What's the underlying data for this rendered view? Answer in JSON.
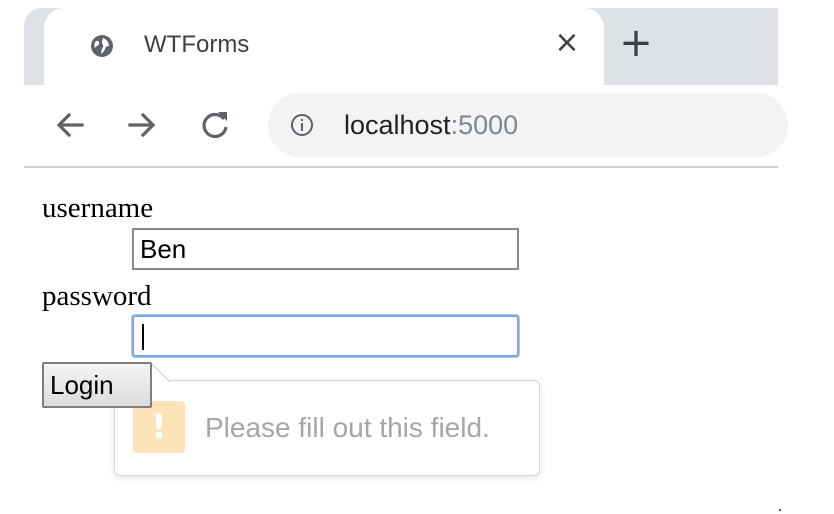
{
  "browser": {
    "tab": {
      "title": "WTForms",
      "favicon": "globe-icon",
      "close_symbol": "×"
    },
    "new_tab_symbol": "+",
    "nav": {
      "back": "arrow-left-icon",
      "forward": "arrow-right-icon",
      "reload": "reload-icon"
    },
    "address": {
      "info": "info-icon",
      "host": "localhost",
      "port": ":5000"
    }
  },
  "form": {
    "username_label": "username",
    "username_value": "Ben",
    "password_label": "password",
    "password_value": "",
    "login_label": "Login"
  },
  "validation": {
    "icon": "warning-icon",
    "icon_symbol": "!",
    "message": "Please fill out this field."
  },
  "colors": {
    "tabstrip": "#dee1e6",
    "omnibox": "#f1f3f4",
    "focus_border": "#7aa6e8",
    "warning_bg": "#fde3b8",
    "tooltip_text": "#a6a6a6"
  }
}
